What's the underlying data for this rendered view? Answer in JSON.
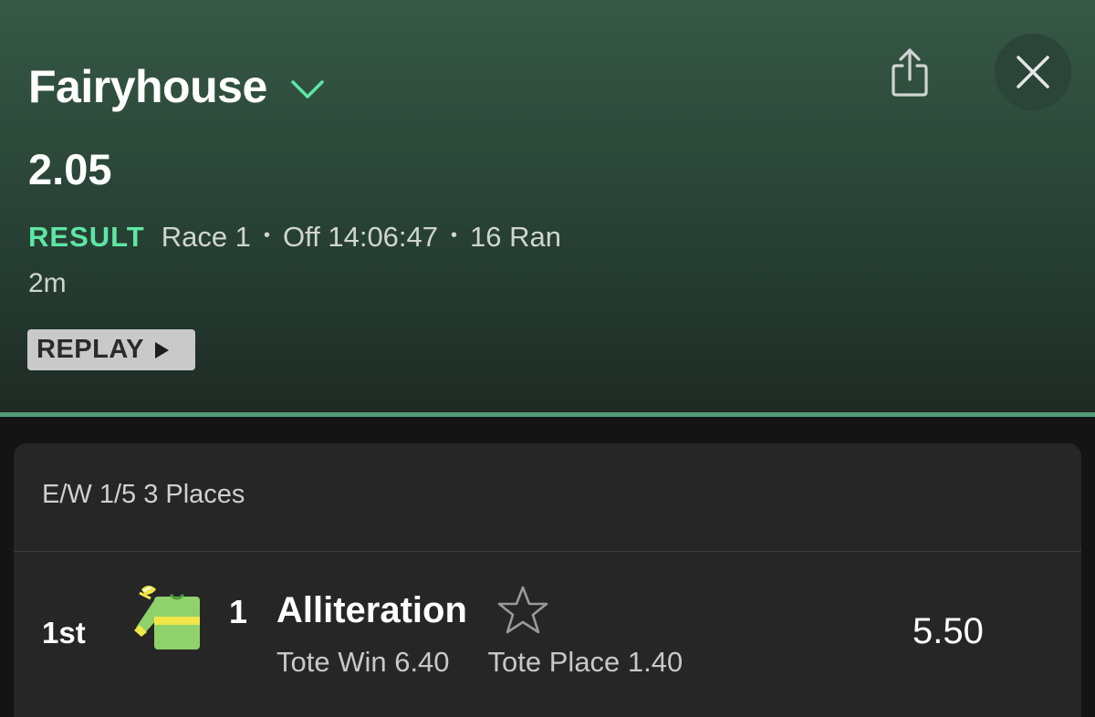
{
  "header": {
    "venue": "Fairyhouse",
    "race_time": "2.05",
    "status": "RESULT",
    "race_label": "Race 1",
    "off_time": "Off 14:06:47",
    "runners": "16 Ran",
    "separator": "•",
    "distance": "2m",
    "replay_label": "REPLAY"
  },
  "icons": {
    "venue_dropdown": "chevron-down-icon",
    "share": "share-icon",
    "close": "close-icon",
    "replay": "play-icon",
    "favourite": "star-icon",
    "silks": "jockey-silks-icon"
  },
  "colors": {
    "status": "#5ee6a4",
    "accent_line": "#4f9c77",
    "silks_green": "#8fd16a",
    "silks_yellow": "#f1e64a"
  },
  "market": {
    "each_way_terms": "E/W 1/5 3 Places"
  },
  "runners_list": [
    {
      "position": "1st",
      "number": "1",
      "name": "Alliteration",
      "tote_win": "Tote Win 6.40",
      "tote_place": "Tote Place 1.40",
      "odds": "5.50"
    }
  ]
}
